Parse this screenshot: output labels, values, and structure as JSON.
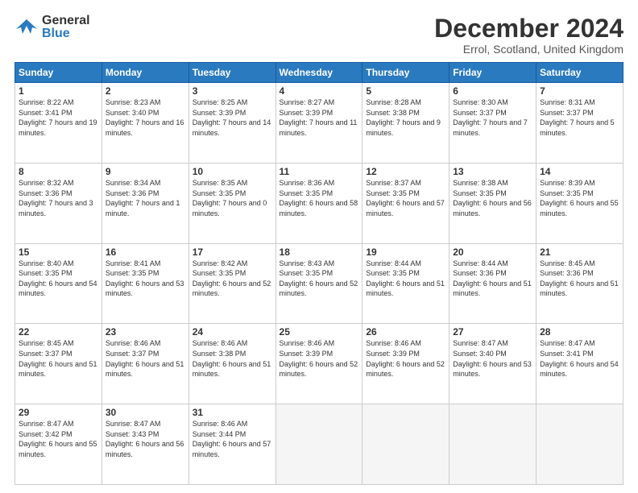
{
  "header": {
    "logo_general": "General",
    "logo_blue": "Blue",
    "month_title": "December 2024",
    "location": "Errol, Scotland, United Kingdom"
  },
  "weekdays": [
    "Sunday",
    "Monday",
    "Tuesday",
    "Wednesday",
    "Thursday",
    "Friday",
    "Saturday"
  ],
  "weeks": [
    [
      {
        "day": "1",
        "sunrise": "Sunrise: 8:22 AM",
        "sunset": "Sunset: 3:41 PM",
        "daylight": "Daylight: 7 hours and 19 minutes."
      },
      {
        "day": "2",
        "sunrise": "Sunrise: 8:23 AM",
        "sunset": "Sunset: 3:40 PM",
        "daylight": "Daylight: 7 hours and 16 minutes."
      },
      {
        "day": "3",
        "sunrise": "Sunrise: 8:25 AM",
        "sunset": "Sunset: 3:39 PM",
        "daylight": "Daylight: 7 hours and 14 minutes."
      },
      {
        "day": "4",
        "sunrise": "Sunrise: 8:27 AM",
        "sunset": "Sunset: 3:39 PM",
        "daylight": "Daylight: 7 hours and 11 minutes."
      },
      {
        "day": "5",
        "sunrise": "Sunrise: 8:28 AM",
        "sunset": "Sunset: 3:38 PM",
        "daylight": "Daylight: 7 hours and 9 minutes."
      },
      {
        "day": "6",
        "sunrise": "Sunrise: 8:30 AM",
        "sunset": "Sunset: 3:37 PM",
        "daylight": "Daylight: 7 hours and 7 minutes."
      },
      {
        "day": "7",
        "sunrise": "Sunrise: 8:31 AM",
        "sunset": "Sunset: 3:37 PM",
        "daylight": "Daylight: 7 hours and 5 minutes."
      }
    ],
    [
      {
        "day": "8",
        "sunrise": "Sunrise: 8:32 AM",
        "sunset": "Sunset: 3:36 PM",
        "daylight": "Daylight: 7 hours and 3 minutes."
      },
      {
        "day": "9",
        "sunrise": "Sunrise: 8:34 AM",
        "sunset": "Sunset: 3:36 PM",
        "daylight": "Daylight: 7 hours and 1 minute."
      },
      {
        "day": "10",
        "sunrise": "Sunrise: 8:35 AM",
        "sunset": "Sunset: 3:35 PM",
        "daylight": "Daylight: 7 hours and 0 minutes."
      },
      {
        "day": "11",
        "sunrise": "Sunrise: 8:36 AM",
        "sunset": "Sunset: 3:35 PM",
        "daylight": "Daylight: 6 hours and 58 minutes."
      },
      {
        "day": "12",
        "sunrise": "Sunrise: 8:37 AM",
        "sunset": "Sunset: 3:35 PM",
        "daylight": "Daylight: 6 hours and 57 minutes."
      },
      {
        "day": "13",
        "sunrise": "Sunrise: 8:38 AM",
        "sunset": "Sunset: 3:35 PM",
        "daylight": "Daylight: 6 hours and 56 minutes."
      },
      {
        "day": "14",
        "sunrise": "Sunrise: 8:39 AM",
        "sunset": "Sunset: 3:35 PM",
        "daylight": "Daylight: 6 hours and 55 minutes."
      }
    ],
    [
      {
        "day": "15",
        "sunrise": "Sunrise: 8:40 AM",
        "sunset": "Sunset: 3:35 PM",
        "daylight": "Daylight: 6 hours and 54 minutes."
      },
      {
        "day": "16",
        "sunrise": "Sunrise: 8:41 AM",
        "sunset": "Sunset: 3:35 PM",
        "daylight": "Daylight: 6 hours and 53 minutes."
      },
      {
        "day": "17",
        "sunrise": "Sunrise: 8:42 AM",
        "sunset": "Sunset: 3:35 PM",
        "daylight": "Daylight: 6 hours and 52 minutes."
      },
      {
        "day": "18",
        "sunrise": "Sunrise: 8:43 AM",
        "sunset": "Sunset: 3:35 PM",
        "daylight": "Daylight: 6 hours and 52 minutes."
      },
      {
        "day": "19",
        "sunrise": "Sunrise: 8:44 AM",
        "sunset": "Sunset: 3:35 PM",
        "daylight": "Daylight: 6 hours and 51 minutes."
      },
      {
        "day": "20",
        "sunrise": "Sunrise: 8:44 AM",
        "sunset": "Sunset: 3:36 PM",
        "daylight": "Daylight: 6 hours and 51 minutes."
      },
      {
        "day": "21",
        "sunrise": "Sunrise: 8:45 AM",
        "sunset": "Sunset: 3:36 PM",
        "daylight": "Daylight: 6 hours and 51 minutes."
      }
    ],
    [
      {
        "day": "22",
        "sunrise": "Sunrise: 8:45 AM",
        "sunset": "Sunset: 3:37 PM",
        "daylight": "Daylight: 6 hours and 51 minutes."
      },
      {
        "day": "23",
        "sunrise": "Sunrise: 8:46 AM",
        "sunset": "Sunset: 3:37 PM",
        "daylight": "Daylight: 6 hours and 51 minutes."
      },
      {
        "day": "24",
        "sunrise": "Sunrise: 8:46 AM",
        "sunset": "Sunset: 3:38 PM",
        "daylight": "Daylight: 6 hours and 51 minutes."
      },
      {
        "day": "25",
        "sunrise": "Sunrise: 8:46 AM",
        "sunset": "Sunset: 3:39 PM",
        "daylight": "Daylight: 6 hours and 52 minutes."
      },
      {
        "day": "26",
        "sunrise": "Sunrise: 8:46 AM",
        "sunset": "Sunset: 3:39 PM",
        "daylight": "Daylight: 6 hours and 52 minutes."
      },
      {
        "day": "27",
        "sunrise": "Sunrise: 8:47 AM",
        "sunset": "Sunset: 3:40 PM",
        "daylight": "Daylight: 6 hours and 53 minutes."
      },
      {
        "day": "28",
        "sunrise": "Sunrise: 8:47 AM",
        "sunset": "Sunset: 3:41 PM",
        "daylight": "Daylight: 6 hours and 54 minutes."
      }
    ],
    [
      {
        "day": "29",
        "sunrise": "Sunrise: 8:47 AM",
        "sunset": "Sunset: 3:42 PM",
        "daylight": "Daylight: 6 hours and 55 minutes."
      },
      {
        "day": "30",
        "sunrise": "Sunrise: 8:47 AM",
        "sunset": "Sunset: 3:43 PM",
        "daylight": "Daylight: 6 hours and 56 minutes."
      },
      {
        "day": "31",
        "sunrise": "Sunrise: 8:46 AM",
        "sunset": "Sunset: 3:44 PM",
        "daylight": "Daylight: 6 hours and 57 minutes."
      },
      null,
      null,
      null,
      null
    ]
  ]
}
